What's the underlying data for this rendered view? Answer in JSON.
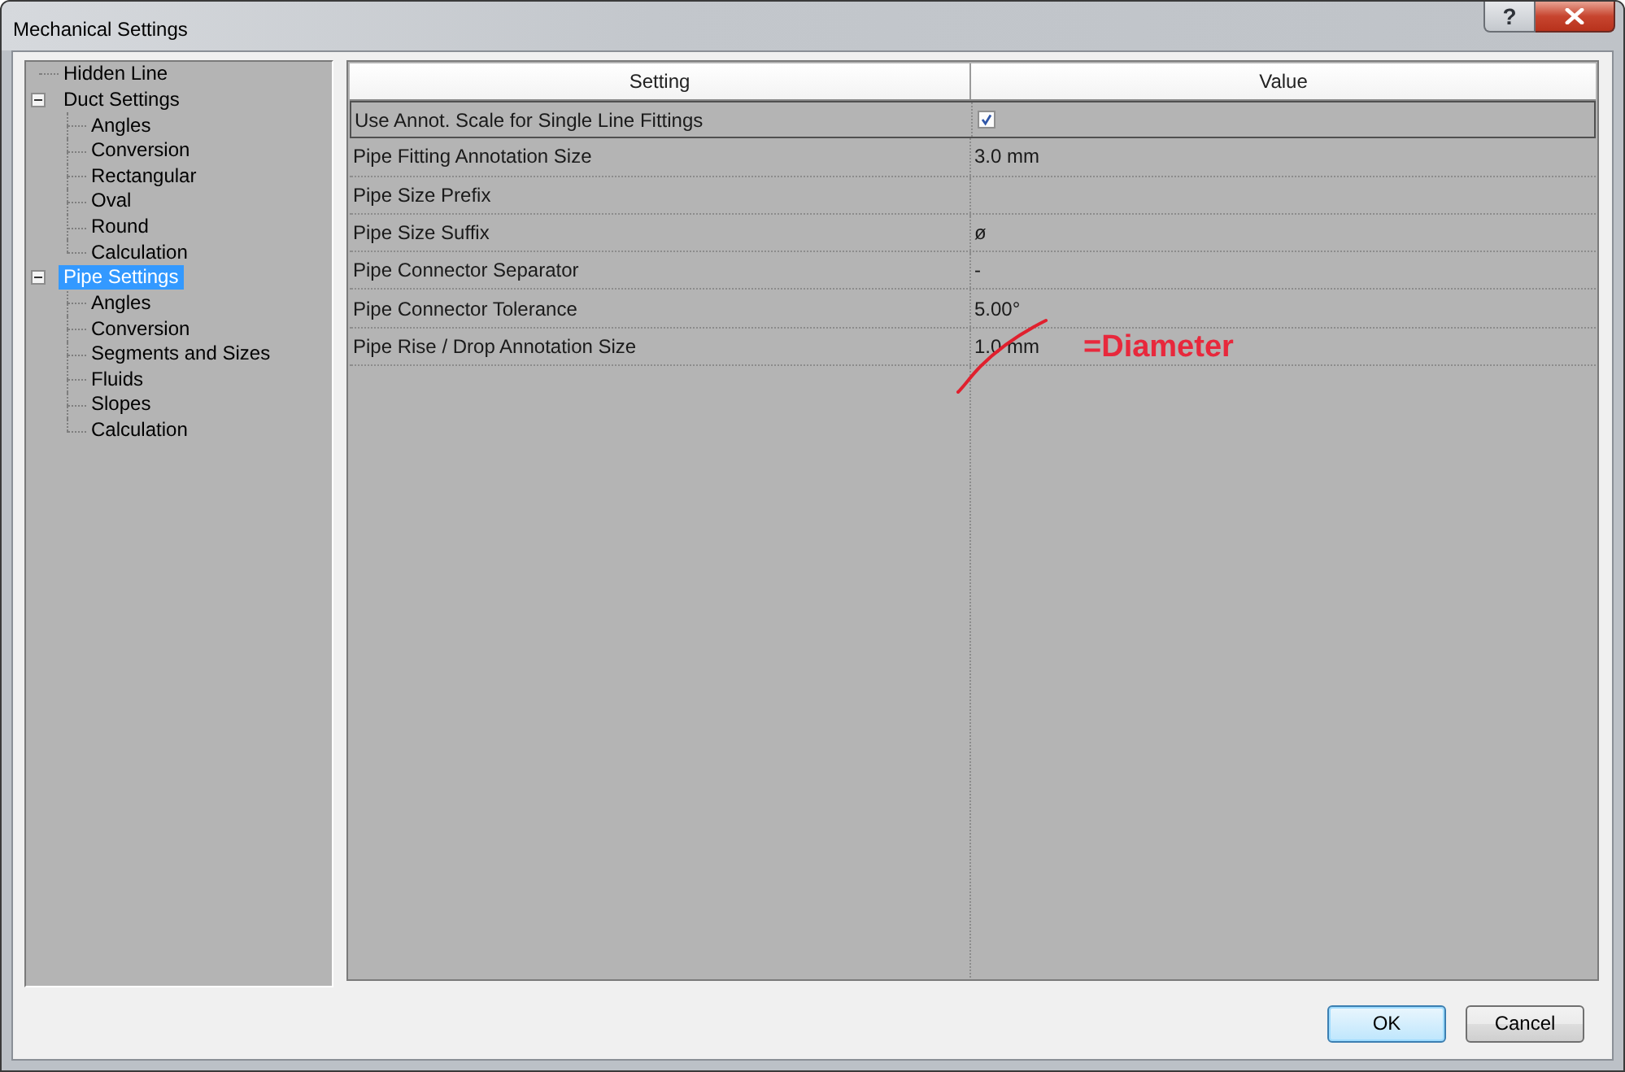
{
  "window": {
    "title": "Mechanical Settings",
    "buttons": [
      {
        "kind": "help",
        "label": "?"
      },
      {
        "kind": "close"
      }
    ]
  },
  "tree": [
    {
      "label": "Hidden Line",
      "selected": false
    },
    {
      "label": "Duct Settings",
      "selected": false,
      "expanded": true,
      "children": [
        {
          "label": "Angles",
          "selected": false
        },
        {
          "label": "Conversion",
          "selected": false
        },
        {
          "label": "Rectangular",
          "selected": false
        },
        {
          "label": "Oval",
          "selected": false
        },
        {
          "label": "Round",
          "selected": false
        },
        {
          "label": "Calculation",
          "selected": false
        }
      ]
    },
    {
      "label": "Pipe Settings",
      "selected": true,
      "expanded": true,
      "children": [
        {
          "label": "Angles",
          "selected": false
        },
        {
          "label": "Conversion",
          "selected": false
        },
        {
          "label": "Segments and Sizes",
          "selected": false
        },
        {
          "label": "Fluids",
          "selected": false
        },
        {
          "label": "Slopes",
          "selected": false
        },
        {
          "label": "Calculation",
          "selected": false
        }
      ]
    }
  ],
  "table": {
    "columns": [
      "Setting",
      "Value"
    ],
    "rows": [
      {
        "setting": "Use Annot. Scale for Single Line Fittings",
        "kind": "checkbox",
        "checked": true,
        "selected": true
      },
      {
        "setting": "Pipe Fitting Annotation Size",
        "kind": "text",
        "value": "3.0 mm",
        "selected": false
      },
      {
        "setting": "Pipe Size Prefix",
        "kind": "text",
        "selected": false
      },
      {
        "setting": "Pipe Size Suffix",
        "kind": "text",
        "value": "ø",
        "selected": false
      },
      {
        "setting": "Pipe Connector Separator",
        "kind": "text",
        "value": "-",
        "selected": false
      },
      {
        "setting": "Pipe Connector Tolerance",
        "kind": "text",
        "value": "5.00°",
        "selected": false
      },
      {
        "setting": "Pipe Rise / Drop Annotation Size",
        "kind": "text",
        "value": "1.0 mm",
        "selected": false
      }
    ]
  },
  "annotation": {
    "text": "=Diameter"
  },
  "buttons": [
    {
      "label": "OK",
      "default": true
    },
    {
      "label": "Cancel",
      "default": false
    }
  ]
}
